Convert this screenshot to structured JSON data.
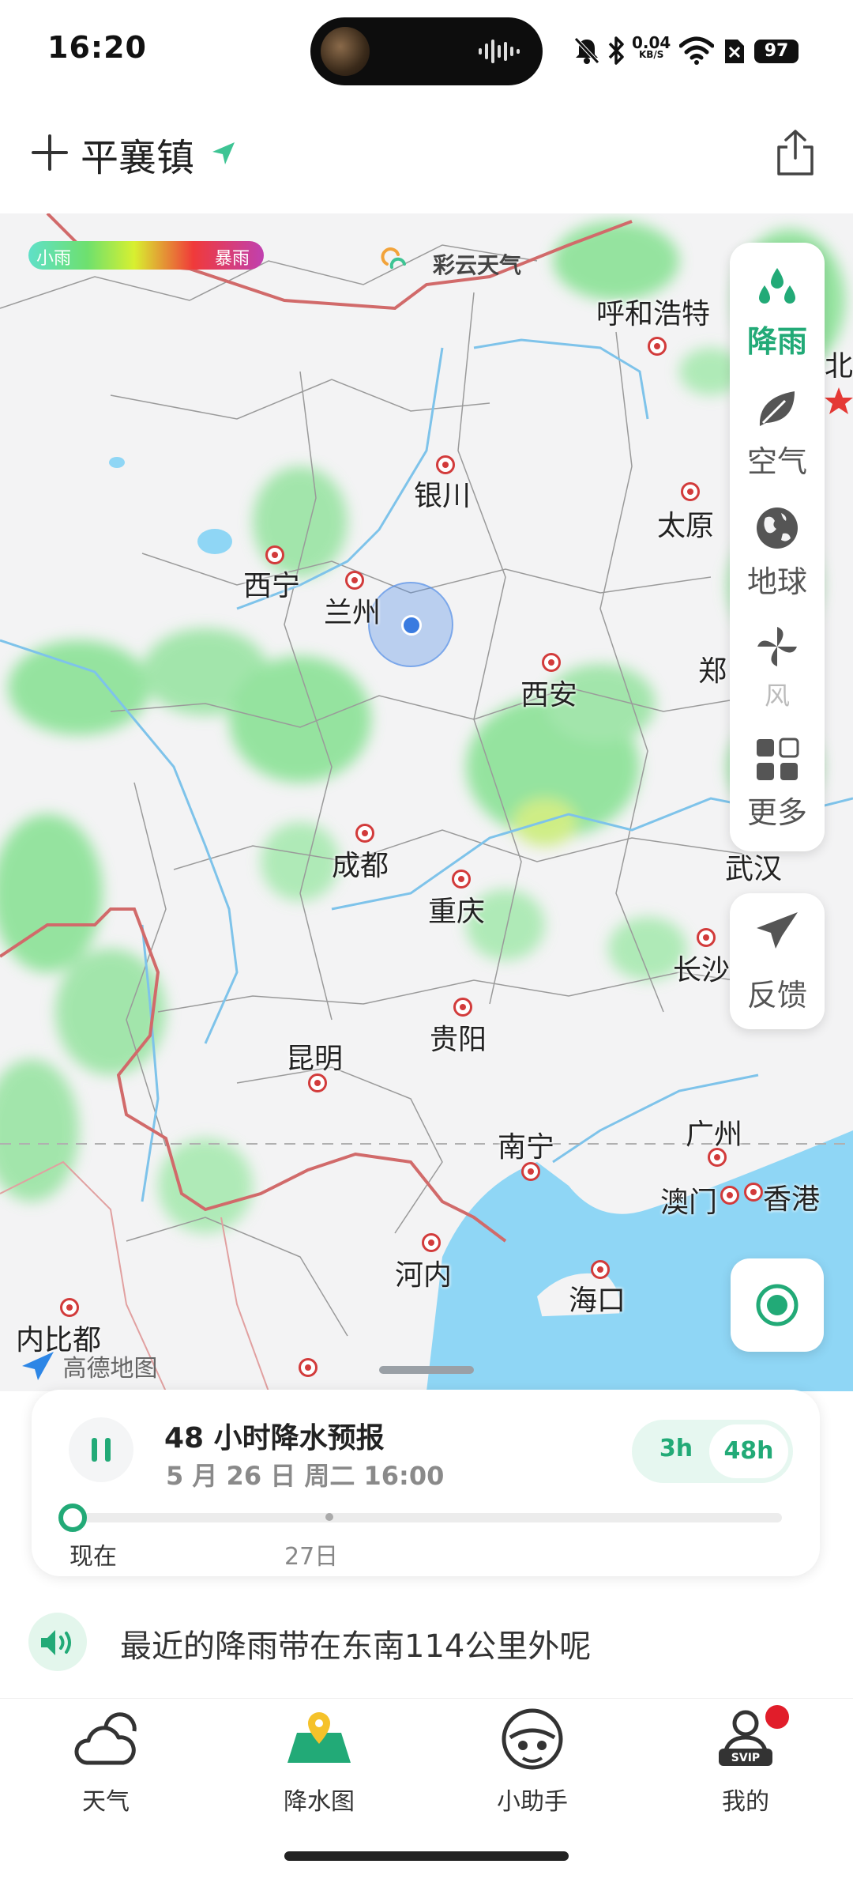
{
  "status_bar": {
    "time": "16:20",
    "net_speed_value": "0.04",
    "net_speed_unit": "KB/S",
    "battery": "97"
  },
  "header": {
    "location": "平襄镇"
  },
  "map": {
    "legend_low": "小雨",
    "legend_high": "暴雨",
    "provider": "彩云天气",
    "map_provider": "高德地图",
    "cities": {
      "hohhot": "呼和浩特",
      "beijing": "北京",
      "yinchuan": "银川",
      "taiyuan": "太原",
      "xining": "西宁",
      "lanzhou": "兰州",
      "xian": "西安",
      "zhengzhou": "郑",
      "chengdu": "成都",
      "chongqing": "重庆",
      "wuhan": "武汉",
      "changsha": "长沙",
      "guiyang": "贵阳",
      "kunming": "昆明",
      "nanning": "南宁",
      "guangzhou": "广州",
      "macau": "澳门",
      "hongkong": "香港",
      "hanoi": "河内",
      "haikou": "海口",
      "naypyidaw": "内比都"
    }
  },
  "layers": {
    "rain": "降雨",
    "air": "空气",
    "earth": "地球",
    "wind": "风",
    "more": "更多"
  },
  "feedback": "反馈",
  "forecast": {
    "title": "48 小时降水预报",
    "time": "5 月 26 日 周二 16:00",
    "range_short": "3h",
    "range_long": "48h",
    "selected_range": "48h",
    "label_now": "现在",
    "label_next_day": "27日"
  },
  "message": "最近的降雨带在东南114公里外呢",
  "nav": {
    "weather": "天气",
    "rain_map": "降水图",
    "assistant": "小助手",
    "mine": "我的",
    "mine_badge": "SVIP"
  },
  "colors": {
    "accent": "#22aa77",
    "marker": "#d23b3b",
    "sea": "#8fd6f5",
    "rain_light": "#7ee08a"
  }
}
